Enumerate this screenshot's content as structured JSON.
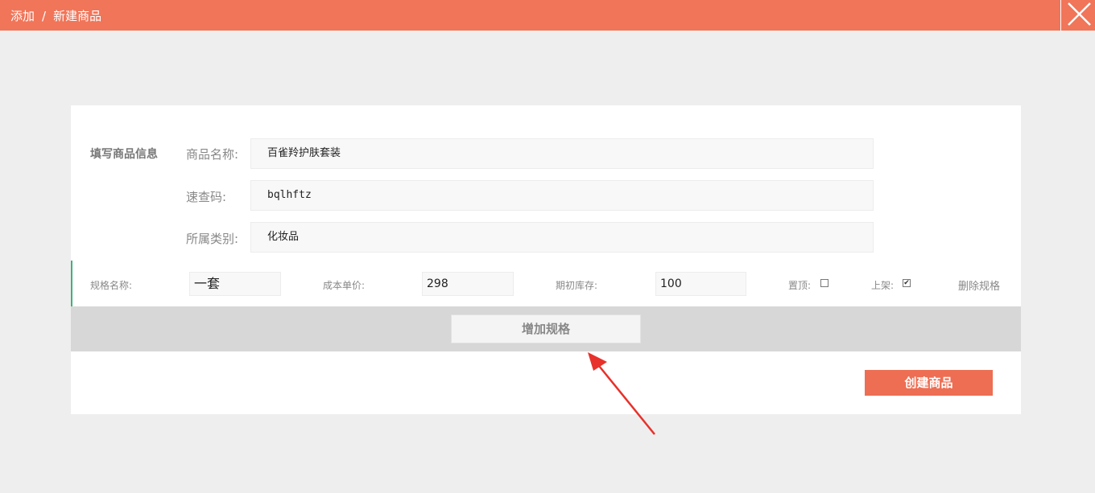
{
  "header": {
    "crumb_part1": "添加",
    "separator": "/",
    "crumb_part2": "新建商品",
    "bg_color": "#f07559",
    "close_icon": "close-icon"
  },
  "form": {
    "section_label": "填写商品信息",
    "fields": [
      {
        "label": "商品名称:",
        "value": "百雀羚护肤套装"
      },
      {
        "label": "速查码:",
        "value": "bqlhftz"
      },
      {
        "label": "所属类别:",
        "value": "化妆品"
      }
    ]
  },
  "spec": {
    "name_label": "规格名称:",
    "name_value": "一套",
    "cost_label": "成本单价:",
    "cost_value": "298",
    "stock_label": "期初库存:",
    "stock_value": "100",
    "top_label": "置顶:",
    "top_checked": false,
    "shelf_label": "上架:",
    "shelf_checked": true,
    "delete_label": "删除规格",
    "accent_color": "#3cb37a"
  },
  "actions": {
    "add_spec_label": "增加规格",
    "create_label": "创建商品",
    "create_color": "#ed6e53"
  },
  "annotation": {
    "arrow_color": "#e8312a",
    "arrow_icon": "red-arrow-icon"
  }
}
